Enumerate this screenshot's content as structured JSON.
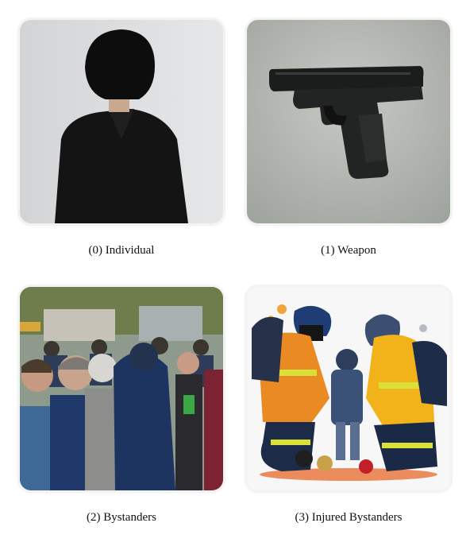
{
  "figures": [
    {
      "caption": "(0) Individual",
      "depicts": "person-back-view"
    },
    {
      "caption": "(1) Weapon",
      "depicts": "handgun"
    },
    {
      "caption": "(2) Bystanders",
      "depicts": "crowd"
    },
    {
      "caption": "(3) Injured Bystanders",
      "depicts": "rescue-workers"
    }
  ]
}
